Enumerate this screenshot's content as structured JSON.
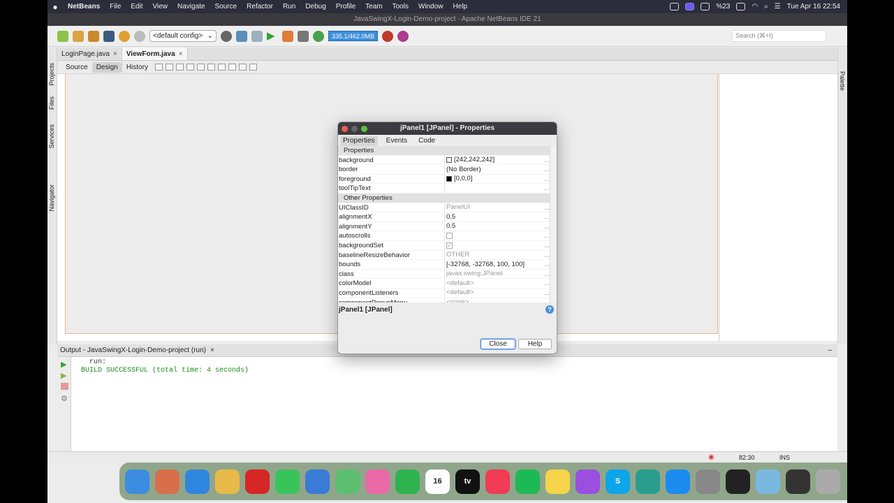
{
  "menubar": {
    "app": "NetBeans",
    "items": [
      "File",
      "Edit",
      "View",
      "Navigate",
      "Source",
      "Refactor",
      "Run",
      "Debug",
      "Profile",
      "Team",
      "Tools",
      "Window",
      "Help"
    ],
    "battery": "%23",
    "datetime": "Tue Apr 16  22:54"
  },
  "window": {
    "title": "JavaSwingX-Login-Demo-project - Apache NetBeans IDE 21"
  },
  "toolbar": {
    "config": "<default config>",
    "memory": "335.1/462.0MB",
    "search_placeholder": "Search (⌘+I)"
  },
  "side": {
    "left": [
      "Projects",
      "Files",
      "Services",
      "Navigator"
    ],
    "right": "Palette"
  },
  "editor": {
    "tabs": [
      {
        "label": "LoginPage.java",
        "active": false
      },
      {
        "label": "ViewForm.java",
        "active": true
      }
    ],
    "views": [
      "Source",
      "Design",
      "History"
    ],
    "active_view": "Design"
  },
  "dialog": {
    "title": "jPanel1 [JPanel] - Properties",
    "tabs": [
      "Properties",
      "Events",
      "Code"
    ],
    "section1": "Properties",
    "props": [
      {
        "k": "background",
        "v": "[242,242,242]",
        "sw": "#f2f2f2"
      },
      {
        "k": "border",
        "v": "(No Border)"
      },
      {
        "k": "foreground",
        "v": "[0,0,0]",
        "sw": "#000000"
      },
      {
        "k": "toolTipText",
        "v": ""
      }
    ],
    "section2": "Other Properties",
    "other": [
      {
        "k": "UIClassID",
        "v": "PanelUI",
        "dim": true
      },
      {
        "k": "alignmentX",
        "v": "0.5"
      },
      {
        "k": "alignmentY",
        "v": "0.5"
      },
      {
        "k": "autoscrolls",
        "v": "",
        "chk": "empty"
      },
      {
        "k": "backgroundSet",
        "v": "",
        "chk": "checked"
      },
      {
        "k": "baselineResizeBehavior",
        "v": "OTHER",
        "dim": true
      },
      {
        "k": "bounds",
        "v": "[-32768, -32768, 100, 100]"
      },
      {
        "k": "class",
        "v": "javax.swing.JPanel",
        "dim": true
      },
      {
        "k": "colorModel",
        "v": "<default>",
        "dim": true
      },
      {
        "k": "componentListeners",
        "v": "<default>",
        "dim": true
      },
      {
        "k": "componentPopupMenu",
        "v": "<none>",
        "dim": true
      }
    ],
    "description": "jPanel1 [JPanel]",
    "close": "Close",
    "help": "Help"
  },
  "output": {
    "title": "Output - JavaSwingX-Login-Demo-project (run)",
    "lines": [
      "run:",
      "BUILD SUCCESSFUL (total time: 4 seconds)"
    ]
  },
  "status": {
    "position": "82:30",
    "mode": "INS"
  },
  "dock": [
    {
      "name": "Finder",
      "c": "#3a8de0"
    },
    {
      "name": "Launchpad",
      "c": "#d86f4a"
    },
    {
      "name": "Safari",
      "c": "#2e86de"
    },
    {
      "name": "Chrome",
      "c": "#e9b949"
    },
    {
      "name": "Opera",
      "c": "#d62626"
    },
    {
      "name": "Messages",
      "c": "#39c45a"
    },
    {
      "name": "Mail",
      "c": "#3a7bd5"
    },
    {
      "name": "Maps",
      "c": "#5bbf6f"
    },
    {
      "name": "Photos",
      "c": "#e96aa6"
    },
    {
      "name": "FaceTime",
      "c": "#2fb34f"
    },
    {
      "name": "Calendar",
      "c": "#ffffff",
      "label": "16"
    },
    {
      "name": "TV",
      "c": "#111111",
      "label": "tv"
    },
    {
      "name": "Music",
      "c": "#f23b55"
    },
    {
      "name": "Spotify",
      "c": "#1db954"
    },
    {
      "name": "Notes",
      "c": "#f5d44a"
    },
    {
      "name": "Podcasts",
      "c": "#9b4ee0"
    },
    {
      "name": "Skype",
      "c": "#0ea5e9",
      "label": "S"
    },
    {
      "name": "Network",
      "c": "#2a9d8f"
    },
    {
      "name": "AppStore",
      "c": "#1c8bf0"
    },
    {
      "name": "Settings",
      "c": "#888888"
    },
    {
      "name": "OBS",
      "c": "#222222"
    },
    {
      "name": "NetBeans",
      "c": "#7ab8e0"
    },
    {
      "name": "Preview",
      "c": "#333333"
    },
    {
      "name": "Trash",
      "c": "#aaaaaa"
    }
  ]
}
